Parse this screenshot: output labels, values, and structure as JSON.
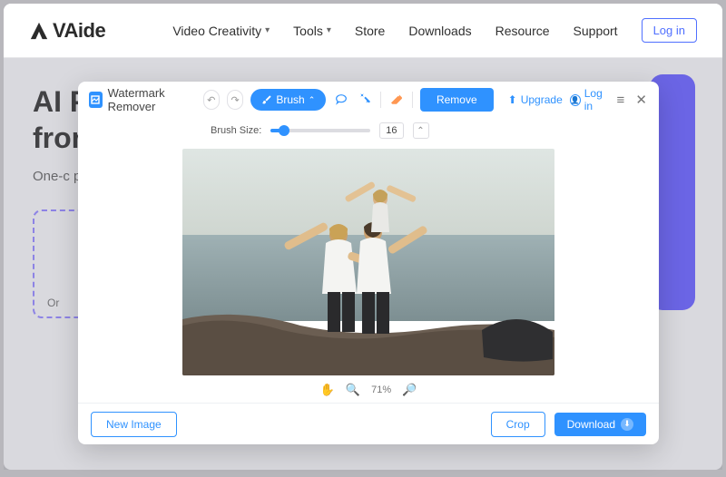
{
  "brand": "VAide",
  "nav": {
    "items": [
      {
        "label": "Video Creativity",
        "dropdown": true
      },
      {
        "label": "Tools",
        "dropdown": true
      },
      {
        "label": "Store",
        "dropdown": false
      },
      {
        "label": "Downloads",
        "dropdown": false
      },
      {
        "label": "Resource",
        "dropdown": false
      },
      {
        "label": "Support",
        "dropdown": false
      }
    ],
    "login": "Log in"
  },
  "hero": {
    "title_line1": "AI P",
    "title_line2": "fron",
    "subtitle": "One-c\nphoto",
    "dropzone_hint": "Or"
  },
  "modal": {
    "title": "Watermark Remover",
    "tools": {
      "brush": "Brush",
      "brush_size_label": "Brush Size:",
      "brush_size_value": "16"
    },
    "remove": "Remove",
    "upgrade": "Upgrade",
    "login": "Log in",
    "zoom": "71%",
    "footer": {
      "new_image": "New Image",
      "crop": "Crop",
      "download": "Download"
    }
  },
  "icons": {
    "undo": "↶",
    "redo": "↷",
    "lasso": "◯",
    "wand": "✦",
    "eraser": "△",
    "up": "▴",
    "down": "▾",
    "hand": "✋",
    "zoom_in": "⊕",
    "zoom_out": "⊖",
    "menu": "≡",
    "close": "✕",
    "user": "◯",
    "arrow_up": "⬆"
  },
  "colors": {
    "primary": "#2f92ff",
    "accent": "#ff8c3f",
    "purple": "#5a52ff"
  }
}
